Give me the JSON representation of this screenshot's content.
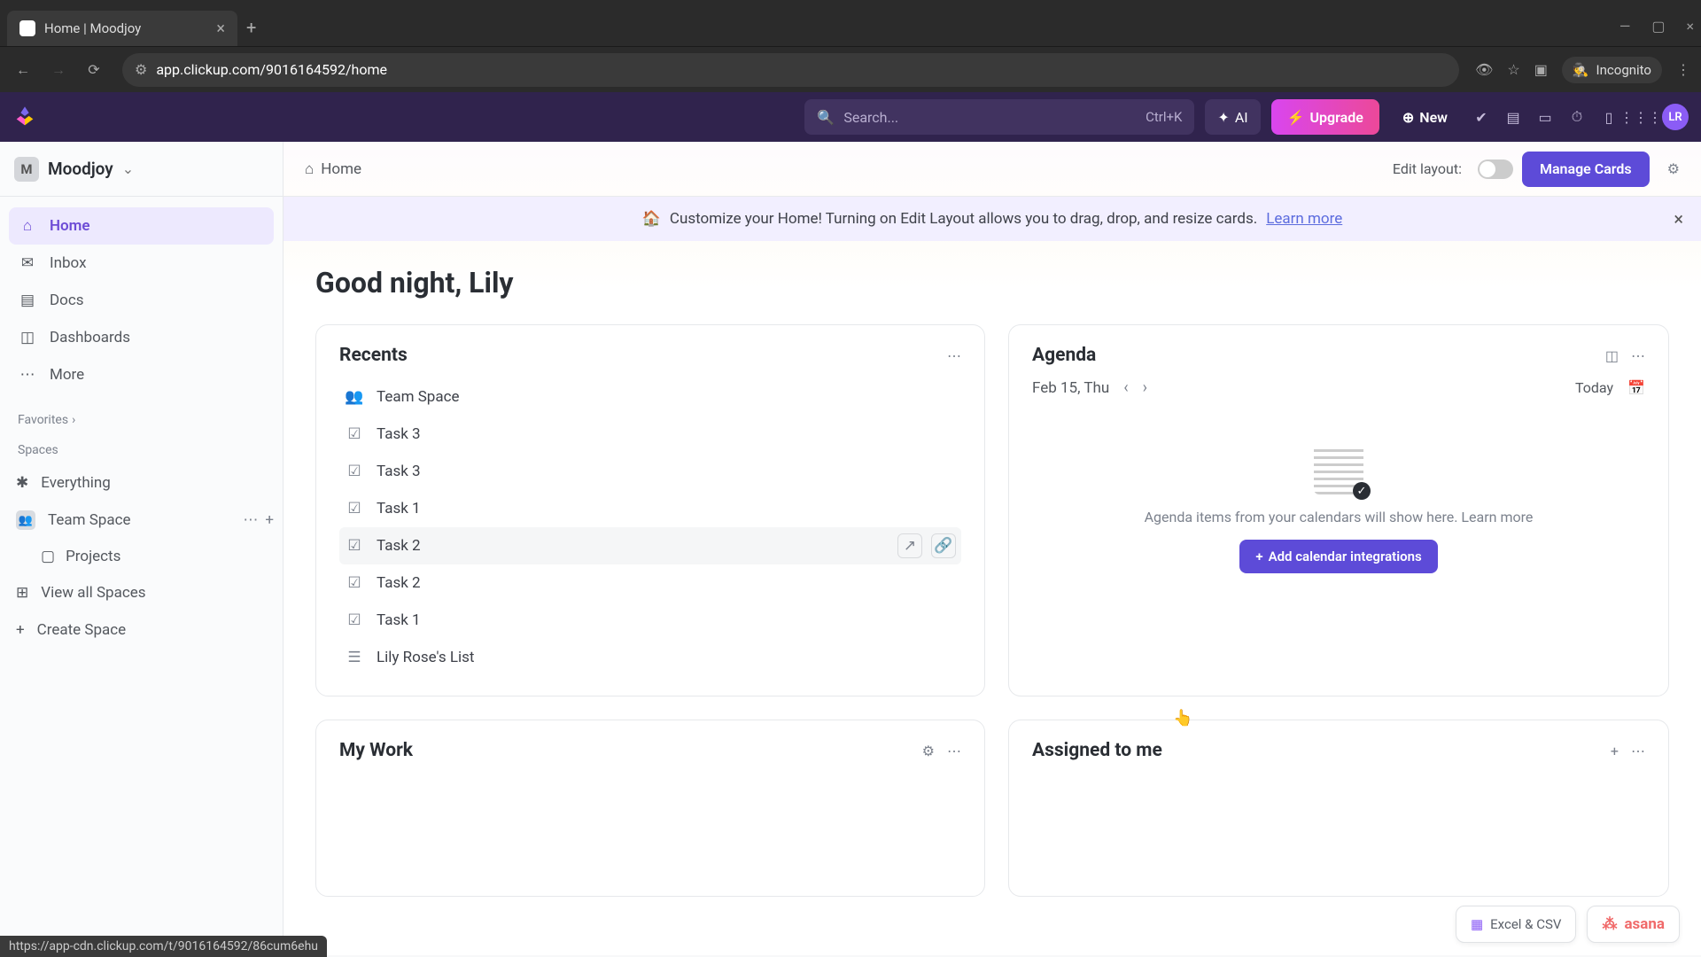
{
  "browser": {
    "tab_title": "Home | Moodjoy",
    "url": "app.clickup.com/9016164592/home",
    "incognito": "Incognito",
    "status_url": "https://app-cdn.clickup.com/t/9016164592/86cum6ehu"
  },
  "topnav": {
    "search_placeholder": "Search...",
    "shortcut": "Ctrl+K",
    "ai_label": "AI",
    "upgrade_label": "Upgrade",
    "new_label": "New",
    "avatar_initials": "LR"
  },
  "sidebar": {
    "workspace_initial": "M",
    "workspace_name": "Moodjoy",
    "nav": {
      "home": "Home",
      "inbox": "Inbox",
      "docs": "Docs",
      "dashboards": "Dashboards",
      "more": "More"
    },
    "favorites_label": "Favorites",
    "spaces_label": "Spaces",
    "everything": "Everything",
    "team_space": "Team Space",
    "projects": "Projects",
    "view_all": "View all Spaces",
    "create_space": "Create Space"
  },
  "main": {
    "breadcrumb_home": "Home",
    "edit_layout": "Edit layout:",
    "manage_cards": "Manage Cards",
    "banner_emoji": "🏠",
    "banner_text": "Customize your Home! Turning on Edit Layout allows you to drag, drop, and resize cards.",
    "banner_link": "Learn more",
    "greeting": "Good night, Lily"
  },
  "recents": {
    "title": "Recents",
    "items": [
      {
        "icon": "team",
        "label": "Team Space"
      },
      {
        "icon": "task",
        "label": "Task 3"
      },
      {
        "icon": "task",
        "label": "Task 3"
      },
      {
        "icon": "task",
        "label": "Task 1"
      },
      {
        "icon": "task",
        "label": "Task 2",
        "hover": true
      },
      {
        "icon": "task",
        "label": "Task 2"
      },
      {
        "icon": "task",
        "label": "Task 1"
      },
      {
        "icon": "list",
        "label": "Lily Rose's List"
      }
    ]
  },
  "agenda": {
    "title": "Agenda",
    "date": "Feb 15, Thu",
    "today": "Today",
    "empty_text": "Agenda items from your calendars will show here.",
    "learn_more": "Learn more",
    "add_btn": "Add calendar integrations"
  },
  "mywork": {
    "title": "My Work"
  },
  "assigned": {
    "title": "Assigned to me"
  },
  "chips": {
    "excel": "Excel & CSV",
    "asana": "asana"
  }
}
